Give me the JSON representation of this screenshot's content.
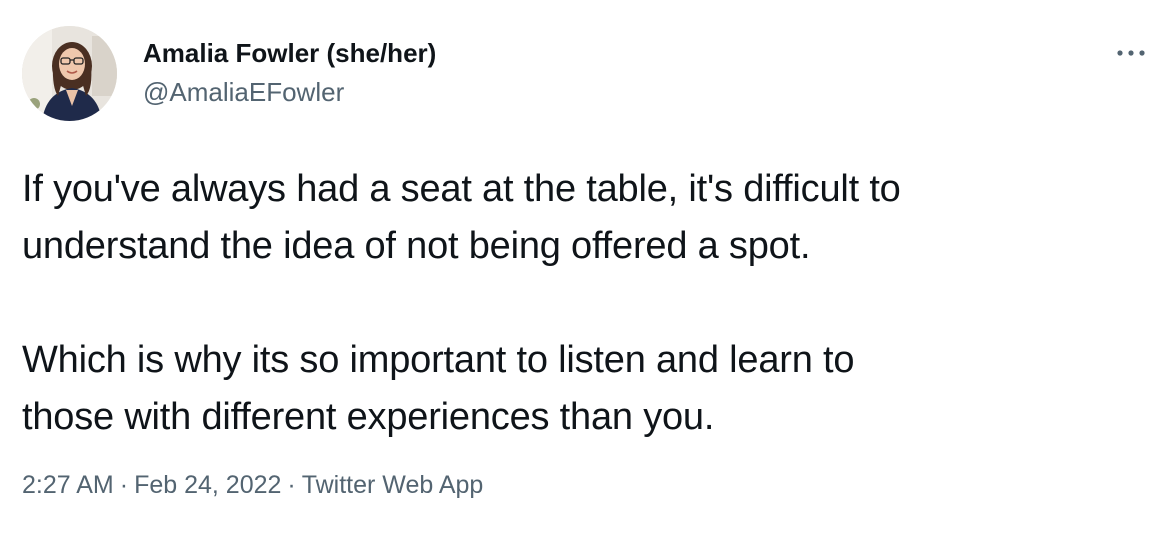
{
  "tweet": {
    "author": {
      "display_name": "Amalia Fowler (she/her)",
      "handle": "@AmaliaEFowler"
    },
    "text": "If you've always had a seat at the table, it's difficult to\nunderstand the idea of not being offered a spot.\n\nWhich is why its so important to listen and learn to\nthose with different experiences than you.",
    "time": "2:27 AM",
    "separator": "·",
    "date": "Feb 24, 2022",
    "source": "Twitter Web App"
  },
  "icons": {
    "more": "more-horizontal-icon",
    "avatar": "profile-photo"
  },
  "colors": {
    "text_primary": "#0f1419",
    "text_secondary": "#536471",
    "background": "#ffffff"
  }
}
